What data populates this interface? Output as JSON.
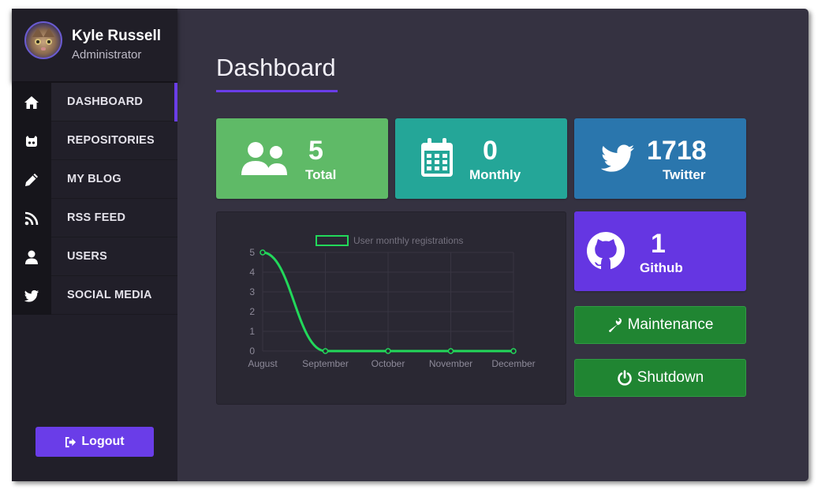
{
  "user": {
    "name": "Kyle Russell",
    "role": "Administrator"
  },
  "nav": {
    "items": [
      {
        "label": "DASHBOARD",
        "icon": "home-icon",
        "active": true
      },
      {
        "label": "REPOSITORIES",
        "icon": "github-octocat-icon",
        "active": false
      },
      {
        "label": "MY BLOG",
        "icon": "pencil-icon",
        "active": false
      },
      {
        "label": "RSS FEED",
        "icon": "rss-icon",
        "active": false
      },
      {
        "label": "USERS",
        "icon": "user-icon",
        "active": false
      },
      {
        "label": "SOCIAL MEDIA",
        "icon": "twitter-icon",
        "active": false
      }
    ]
  },
  "logout_label": "Logout",
  "page": {
    "title": "Dashboard"
  },
  "cards": {
    "total": {
      "value": "5",
      "label": "Total",
      "icon": "users-icon",
      "color": "#5fba67"
    },
    "monthly": {
      "value": "0",
      "label": "Monthly",
      "icon": "calendar-icon",
      "color": "#24a698"
    },
    "twitter": {
      "value": "1718",
      "label": "Twitter",
      "icon": "twitter-icon",
      "color": "#2a76ad"
    },
    "github": {
      "value": "1",
      "label": "Github",
      "icon": "github-icon",
      "color": "#6536e2"
    }
  },
  "buttons": {
    "maintenance": {
      "label": "Maintenance",
      "icon": "wrench-icon"
    },
    "shutdown": {
      "label": "Shutdown",
      "icon": "power-icon"
    }
  },
  "colors": {
    "accent": "#6a3de8",
    "line": "#22d85a",
    "button_green": "#208532"
  },
  "chart_data": {
    "type": "line",
    "categories": [
      "August",
      "September",
      "October",
      "November",
      "December"
    ],
    "series": [
      {
        "name": "User monthly registrations",
        "values": [
          5,
          0,
          0,
          0,
          0
        ]
      }
    ],
    "ylim": [
      0,
      5
    ],
    "yticks": [
      0,
      1,
      2,
      3,
      4,
      5
    ],
    "grid": true,
    "legend": "top-center"
  }
}
